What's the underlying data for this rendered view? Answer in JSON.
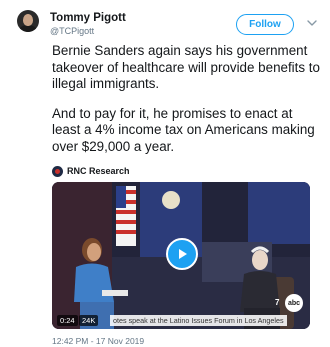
{
  "user": {
    "display_name": "Tommy Pigott",
    "handle": "@TCPigott"
  },
  "follow_button": {
    "label": "Follow"
  },
  "tweet": {
    "paragraphs": [
      "Bernie Sanders again says his government takeover of healthcare will provide benefits to illegal immigrants.",
      "And to pay for it, he promises to enact at least a 4% income tax on Americans making over $29,000 a year."
    ],
    "timestamp": "12:42 PM - 17 Nov 2019"
  },
  "media": {
    "source_name": "RNC Research",
    "video": {
      "duration": "0:24",
      "views": "24K",
      "views_icon": "eye-icon",
      "caption": "otes speak at the Latino Issues Forum in Los Angeles",
      "banner_left_title": "CHIRLA",
      "banner_left_subtitle": "Action Fund",
      "banner_right_logo": "LA",
      "banner_right_text": "PAT BROWN INSTITUTE FOR PUBLIC AFFAIRS",
      "station_number": "7",
      "station_logo": "abc"
    }
  },
  "colors": {
    "accent": "#1da1f2",
    "text": "#14171a",
    "muted": "#657786",
    "stage": "#1f2233",
    "banner": "#2c3c7a"
  }
}
